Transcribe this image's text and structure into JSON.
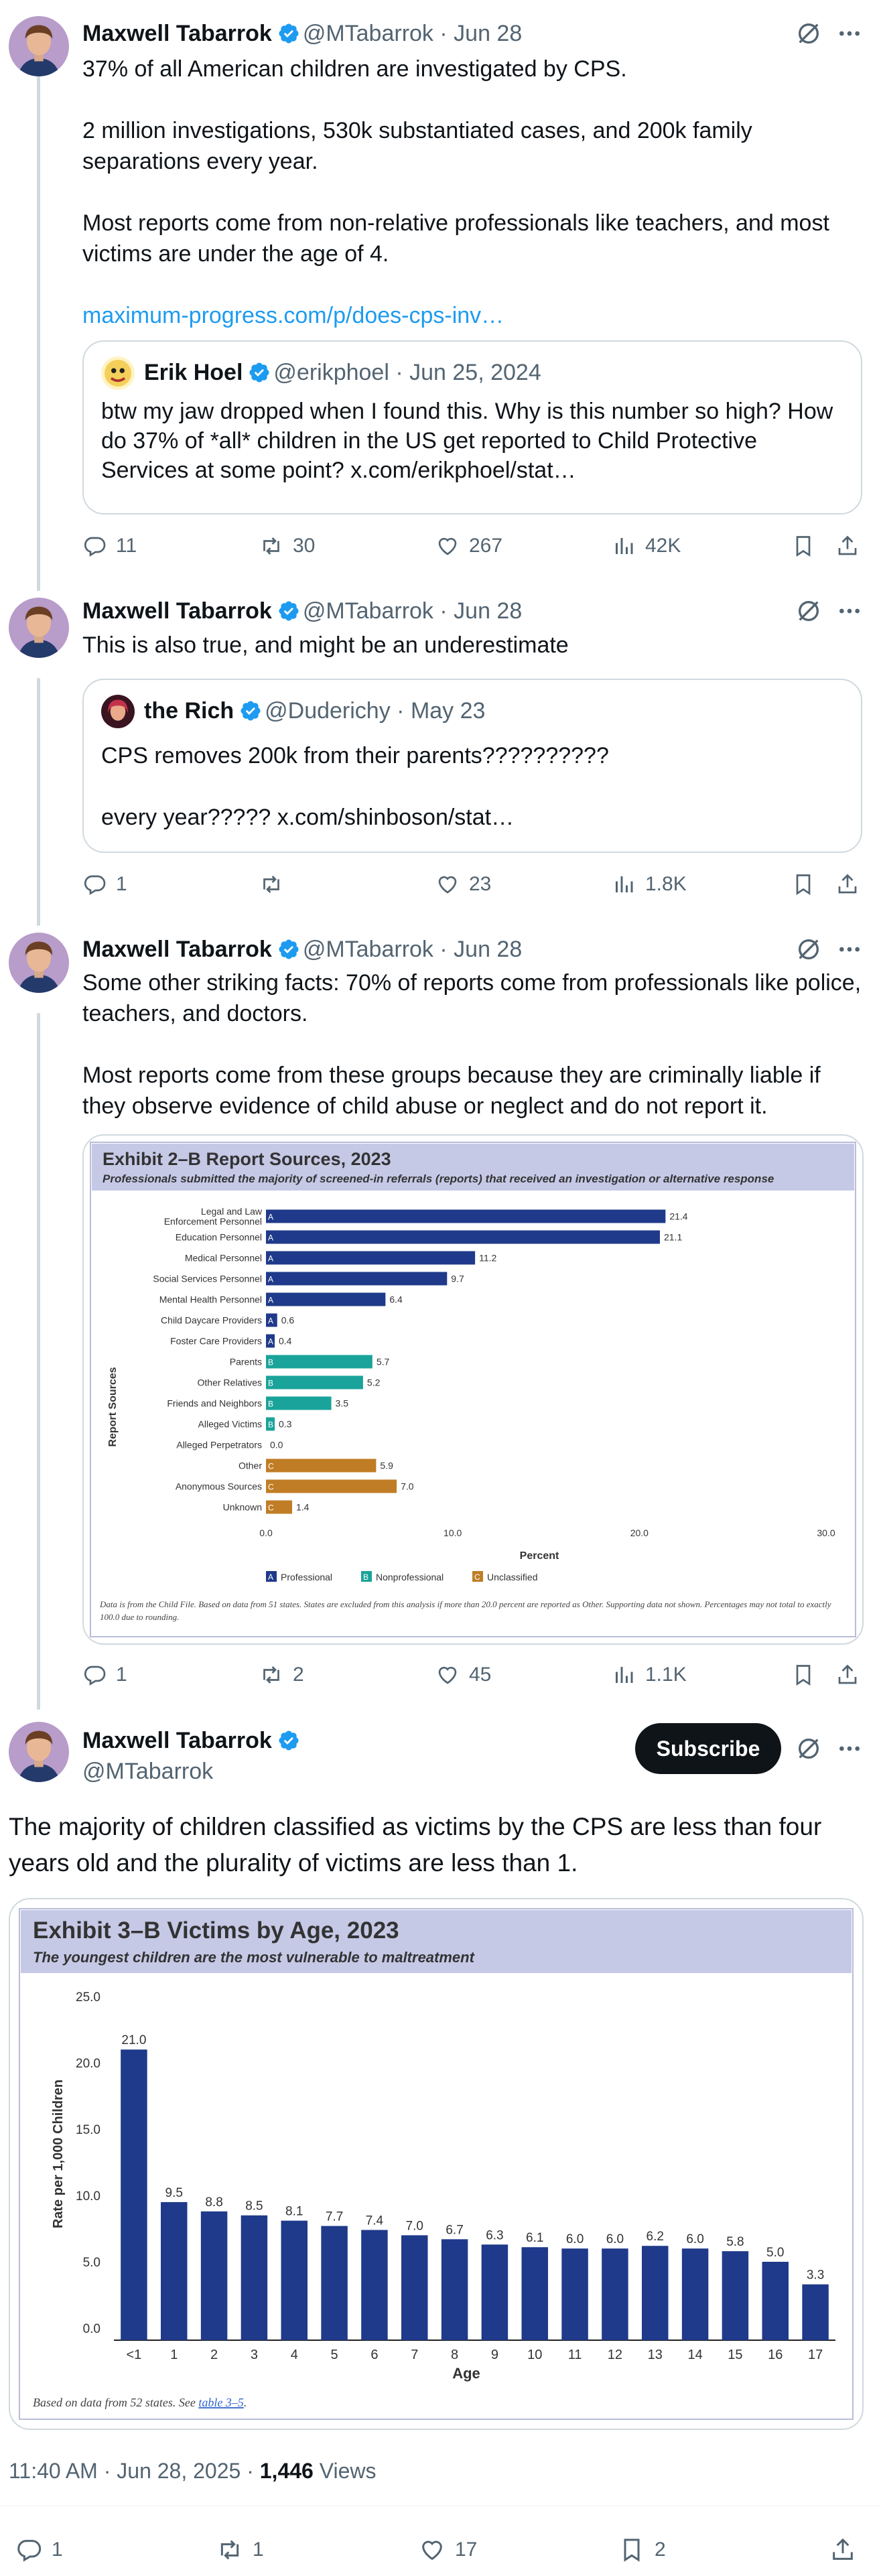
{
  "tweets": [
    {
      "author": "Maxwell Tabarrok",
      "handle": "@MTabarrok",
      "date": "· Jun 28",
      "paragraphs": [
        "37% of all American children are investigated by CPS.",
        "2 million investigations, 530k substantiated cases, and 200k family separations every year.",
        "Most reports come from non-relative professionals like teachers, and most victims are under the age of 4."
      ],
      "link": "maximum-progress.com/p/does-cps-inv…",
      "quote": {
        "author": "Erik Hoel",
        "handle": "@erikphoel",
        "date": "· Jun 25, 2024",
        "text": "btw my jaw dropped when I found this. Why is this number so high? How do 37% of *all* children in the US get reported to Child Protective Services at some point? x.com/erikphoel/stat…"
      },
      "stats": {
        "replies": "11",
        "reposts": "30",
        "likes": "267",
        "views": "42K"
      }
    },
    {
      "author": "Maxwell Tabarrok",
      "handle": "@MTabarrok",
      "date": "· Jun 28",
      "paragraphs": [
        "This is also true, and might be an underestimate"
      ],
      "quote": {
        "author": "the Rich",
        "handle": "@Duderichy",
        "date": "· May 23",
        "text1": "CPS removes 200k from their parents??????????",
        "text2": "every year????? x.com/shinboson/stat…"
      },
      "stats": {
        "replies": "1",
        "reposts": "",
        "likes": "23",
        "views": "1.8K"
      }
    },
    {
      "author": "Maxwell Tabarrok",
      "handle": "@MTabarrok",
      "date": "· Jun 28",
      "paragraphs": [
        "Some other striking facts: 70% of reports come from professionals like police, teachers, and doctors.",
        "Most reports come from these groups because they  are criminally liable if they observe evidence of child abuse or neglect and do not report it."
      ],
      "stats": {
        "replies": "1",
        "reposts": "2",
        "likes": "45",
        "views": "1.1K"
      }
    },
    {
      "author": "Maxwell Tabarrok",
      "handle": "@MTabarrok",
      "subscribe_label": "Subscribe",
      "text": "The majority of children classified as victims by the CPS are less than four years old and the plurality of victims are less than 1.",
      "timestamp": "11:40 AM · Jun 28, 2025 · ",
      "views_count": "1,446",
      "views_label": " Views",
      "stats": {
        "replies": "1",
        "reposts": "1",
        "likes": "17",
        "bookmarks": "2"
      }
    }
  ],
  "colors": {
    "accent": "#1d9bf0",
    "professional": "#1f3a8a",
    "nonprofessional": "#1aa39a",
    "unclassified": "#c07d26",
    "exhibit_header": "#c5c9e6"
  },
  "icons": [
    "verified-badge-icon",
    "grok-icon",
    "more-icon",
    "reply-icon",
    "repost-icon",
    "like-icon",
    "views-icon",
    "bookmark-icon",
    "share-icon"
  ],
  "chart_data": [
    {
      "type": "bar",
      "orientation": "horizontal",
      "title": "Exhibit 2–B Report Sources, 2023",
      "subtitle": "Professionals submitted the majority of screened-in referrals (reports) that received an investigation or alternative response",
      "xlabel": "Percent",
      "ylabel": "Report Sources",
      "xlim": [
        0,
        30
      ],
      "xticks": [
        "0.0",
        "10.0",
        "20.0",
        "30.0"
      ],
      "categories": [
        "Legal and Law Enforcement Personnel",
        "Education Personnel",
        "Medical Personnel",
        "Social Services Personnel",
        "Mental Health Personnel",
        "Child Daycare Providers",
        "Foster Care Providers",
        "Parents",
        "Other Relatives",
        "Friends and Neighbors",
        "Alleged Victims",
        "Alleged Perpetrators",
        "Other",
        "Anonymous Sources",
        "Unknown"
      ],
      "values": [
        21.4,
        21.1,
        11.2,
        9.7,
        6.4,
        0.6,
        0.4,
        5.7,
        5.2,
        3.5,
        0.3,
        0.0,
        5.9,
        7.0,
        1.4
      ],
      "value_labels": [
        "21.4",
        "21.1",
        "11.2",
        "9.7",
        "6.4",
        "0.6",
        "0.4",
        "5.7",
        "5.2",
        "3.5",
        "0.3",
        "0.0",
        "5.9",
        "7.0",
        "1.4"
      ],
      "groups": [
        "A",
        "A",
        "A",
        "A",
        "A",
        "A",
        "A",
        "B",
        "B",
        "B",
        "B",
        "",
        "C",
        "C",
        "C"
      ],
      "legend": [
        {
          "code": "A",
          "label": "Professional"
        },
        {
          "code": "B",
          "label": "Nonprofessional"
        },
        {
          "code": "C",
          "label": "Unclassified"
        }
      ],
      "legend_position": "bottom",
      "footnote": "Data is from the Child File. Based on data from 51 states. States are excluded from this analysis if more than 20.0 percent are reported as Other. Supporting data not shown. Percentages may not total to exactly 100.0 due to rounding."
    },
    {
      "type": "bar",
      "title": "Exhibit 3–B Victims by Age, 2023",
      "subtitle": "The youngest children are the most vulnerable to maltreatment",
      "xlabel": "Age",
      "ylabel": "Rate per 1,000 Children",
      "ylim": [
        0,
        25
      ],
      "yticks": [
        "0.0",
        "5.0",
        "10.0",
        "15.0",
        "20.0",
        "25.0"
      ],
      "categories": [
        "<1",
        "1",
        "2",
        "3",
        "4",
        "5",
        "6",
        "7",
        "8",
        "9",
        "10",
        "11",
        "12",
        "13",
        "14",
        "15",
        "16",
        "17"
      ],
      "values": [
        21.0,
        9.5,
        8.8,
        8.5,
        8.1,
        7.7,
        7.4,
        7.0,
        6.7,
        6.3,
        6.1,
        6.0,
        6.0,
        6.2,
        6.0,
        5.8,
        5.0,
        3.3
      ],
      "value_labels": [
        "21.0",
        "9.5",
        "8.8",
        "8.5",
        "8.1",
        "7.7",
        "7.4",
        "7.0",
        "6.7",
        "6.3",
        "6.1",
        "6.0",
        "6.0",
        "6.2",
        "6.0",
        "5.8",
        "5.0",
        "3.3"
      ],
      "footnote_prefix": "Based on data from 52 states. See ",
      "footnote_link": "table 3–5",
      "footnote_suffix": "."
    }
  ]
}
